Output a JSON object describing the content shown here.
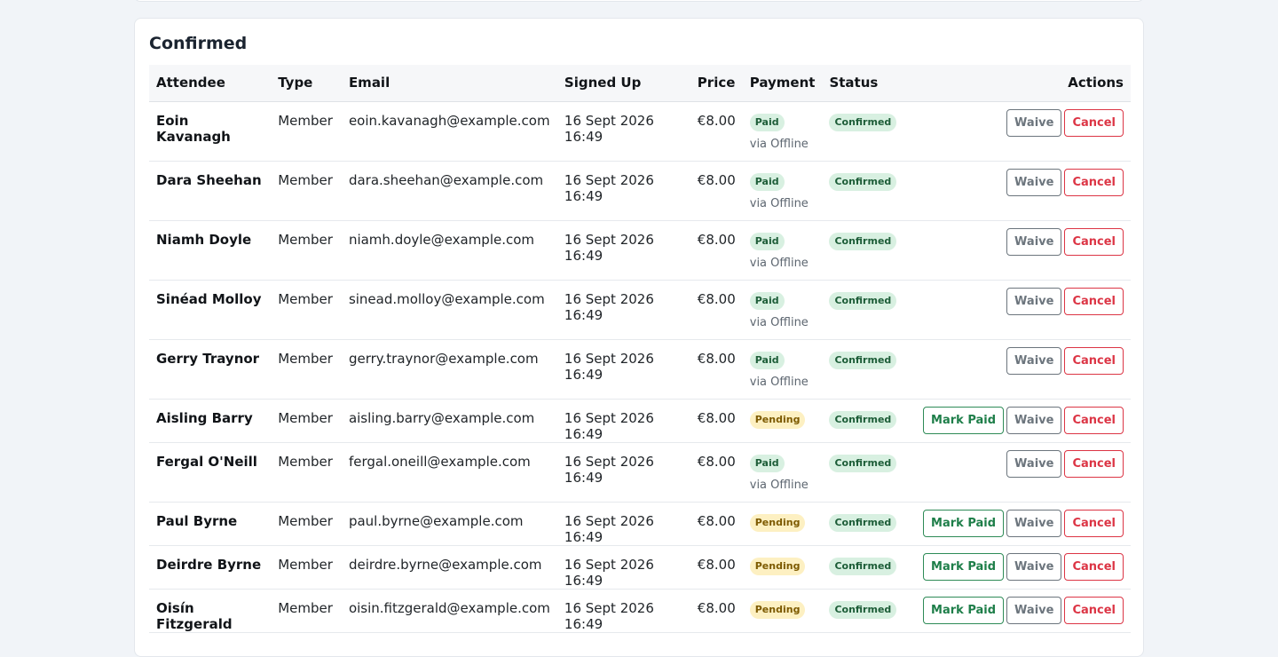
{
  "section": {
    "title": "Confirmed"
  },
  "table": {
    "headers": {
      "attendee": "Attendee",
      "type": "Type",
      "email": "Email",
      "signed_up": "Signed Up",
      "price": "Price",
      "payment": "Payment",
      "status": "Status",
      "actions": "Actions"
    },
    "actions": {
      "mark_paid": "Mark Paid",
      "waive": "Waive",
      "cancel": "Cancel"
    },
    "rows": [
      {
        "name": "Eoin Kavanagh",
        "type": "Member",
        "email": "eoin.kavanagh@example.com",
        "signed_up": "16 Sept 2026 16:49",
        "price": "€8.00",
        "payment": "Paid",
        "via": "via Offline",
        "status": "Confirmed",
        "can_mark_paid": false
      },
      {
        "name": "Dara Sheehan",
        "type": "Member",
        "email": "dara.sheehan@example.com",
        "signed_up": "16 Sept 2026 16:49",
        "price": "€8.00",
        "payment": "Paid",
        "via": "via Offline",
        "status": "Confirmed",
        "can_mark_paid": false
      },
      {
        "name": "Niamh Doyle",
        "type": "Member",
        "email": "niamh.doyle@example.com",
        "signed_up": "16 Sept 2026 16:49",
        "price": "€8.00",
        "payment": "Paid",
        "via": "via Offline",
        "status": "Confirmed",
        "can_mark_paid": false
      },
      {
        "name": "Sinéad Molloy",
        "type": "Member",
        "email": "sinead.molloy@example.com",
        "signed_up": "16 Sept 2026 16:49",
        "price": "€8.00",
        "payment": "Paid",
        "via": "via Offline",
        "status": "Confirmed",
        "can_mark_paid": false
      },
      {
        "name": "Gerry Traynor",
        "type": "Member",
        "email": "gerry.traynor@example.com",
        "signed_up": "16 Sept 2026 16:49",
        "price": "€8.00",
        "payment": "Paid",
        "via": "via Offline",
        "status": "Confirmed",
        "can_mark_paid": false
      },
      {
        "name": "Aisling Barry",
        "type": "Member",
        "email": "aisling.barry@example.com",
        "signed_up": "16 Sept 2026 16:49",
        "price": "€8.00",
        "payment": "Pending",
        "via": "",
        "status": "Confirmed",
        "can_mark_paid": true
      },
      {
        "name": "Fergal O'Neill",
        "type": "Member",
        "email": "fergal.oneill@example.com",
        "signed_up": "16 Sept 2026 16:49",
        "price": "€8.00",
        "payment": "Paid",
        "via": "via Offline",
        "status": "Confirmed",
        "can_mark_paid": false
      },
      {
        "name": "Paul Byrne",
        "type": "Member",
        "email": "paul.byrne@example.com",
        "signed_up": "16 Sept 2026 16:49",
        "price": "€8.00",
        "payment": "Pending",
        "via": "",
        "status": "Confirmed",
        "can_mark_paid": true
      },
      {
        "name": "Deirdre Byrne",
        "type": "Member",
        "email": "deirdre.byrne@example.com",
        "signed_up": "16 Sept 2026 16:49",
        "price": "€8.00",
        "payment": "Pending",
        "via": "",
        "status": "Confirmed",
        "can_mark_paid": true
      },
      {
        "name": "Oisín Fitzgerald",
        "type": "Member",
        "email": "oisin.fitzgerald@example.com",
        "signed_up": "16 Sept 2026 16:49",
        "price": "€8.00",
        "payment": "Pending",
        "via": "",
        "status": "Confirmed",
        "can_mark_paid": true
      }
    ]
  }
}
